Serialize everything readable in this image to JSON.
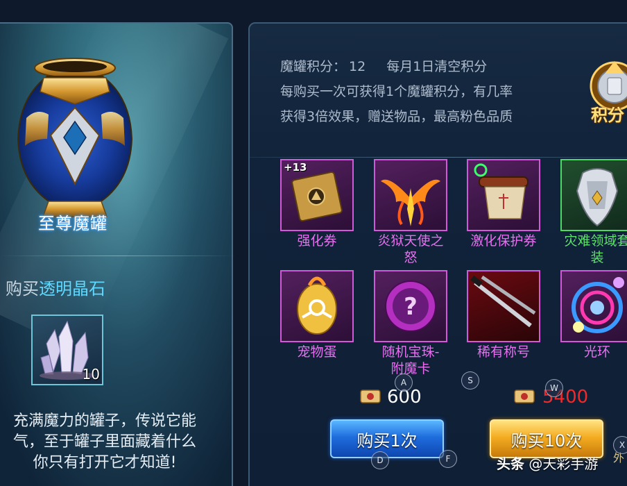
{
  "left": {
    "jar_name": "至尊魔罐",
    "buy_prefix": "购买",
    "buy_item": "透明晶石",
    "crystal_count": "10",
    "desc_lines": [
      "充满魔力的罐子，传说它能",
      "气，至于罐子里面藏着什么",
      "你只有打开它才知道!"
    ]
  },
  "info": {
    "points_label": "魔罐积分：",
    "points_value": "12",
    "reset_note": "每月1日清空积分",
    "line2": "每购买一次可获得1个魔罐积分，有几率",
    "line3": "获得3倍效果，赠送物品，最高粉色品质",
    "badge_label": "积分"
  },
  "items": [
    {
      "name": "强化券",
      "badge": "+13",
      "rarity": "purple",
      "icon": "ticket-icon"
    },
    {
      "name": "炎狱天使之怒",
      "rarity": "purple",
      "icon": "fire-wings-icon"
    },
    {
      "name": "激化保护券",
      "rarity": "purple",
      "icon": "scroll-icon"
    },
    {
      "name": "灾难领域套装",
      "rarity": "green",
      "icon": "armor-icon"
    },
    {
      "name": "宠物蛋",
      "rarity": "purple",
      "icon": "egg-icon"
    },
    {
      "name": "随机宝珠-附魔卡",
      "rarity": "purple",
      "icon": "orb-icon"
    },
    {
      "name": "稀有称号",
      "rarity": "purple",
      "icon": "swords-icon"
    },
    {
      "name": "光环",
      "rarity": "purple",
      "icon": "halo-icon"
    }
  ],
  "item_names_display": {
    "i0": [
      "强化券"
    ],
    "i1": [
      "炎狱天使之",
      "怒"
    ],
    "i2": [
      "激化保护券"
    ],
    "i3": [
      "灾难领域套",
      "装"
    ],
    "i4": [
      "宠物蛋"
    ],
    "i5": [
      "随机宝珠-",
      "附魔卡"
    ],
    "i6": [
      "稀有称号"
    ],
    "i7": [
      "光环"
    ]
  },
  "prices": {
    "single": "600",
    "ten": "5400"
  },
  "buttons": {
    "buy_one": "购买1次",
    "buy_ten": "购买10次"
  },
  "key_hints": [
    "A",
    "S",
    "W",
    "D",
    "F",
    "X"
  ],
  "watermark": {
    "brand": "头条",
    "author": "@天彩手游"
  },
  "edge_text": "外",
  "colors": {
    "rare_purple": "#e86ff0",
    "rare_green": "#5ee26b",
    "price_insufficient": "#f02a2a",
    "highlight": "#5fd9ff"
  }
}
